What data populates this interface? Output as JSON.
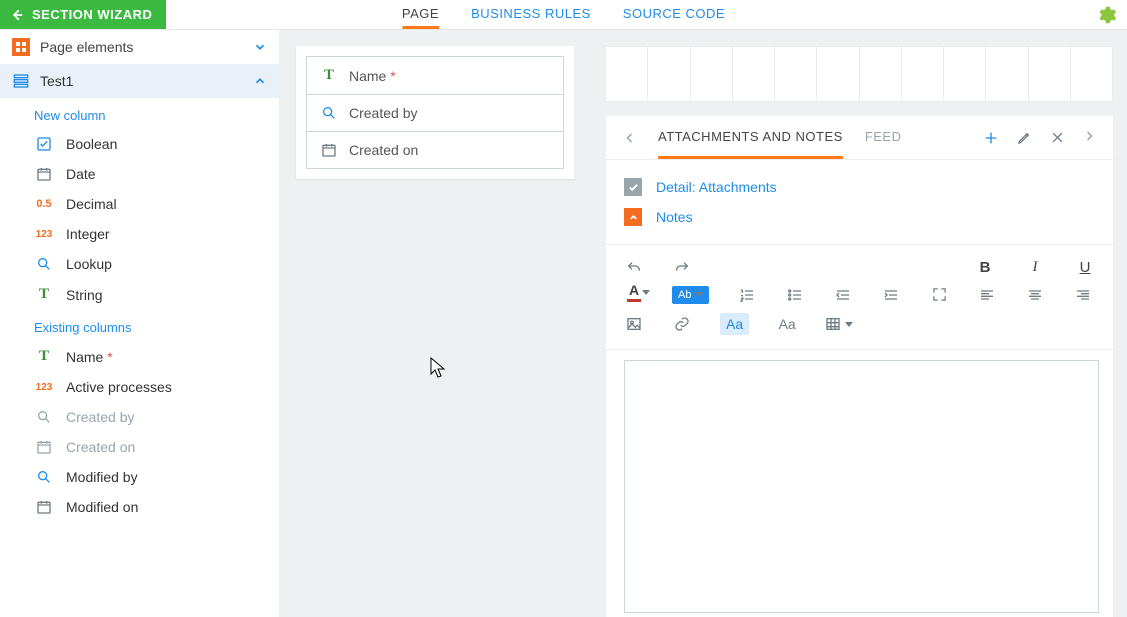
{
  "header": {
    "back_label": "SECTION WIZARD",
    "tabs": [
      "PAGE",
      "BUSINESS RULES",
      "SOURCE CODE"
    ],
    "active_tab": 0
  },
  "sidebar": {
    "page_elements_label": "Page elements",
    "section_label": "Test1",
    "new_column_title": "New column",
    "existing_columns_title": "Existing columns",
    "new_columns": [
      {
        "icon": "checkbox",
        "label": "Boolean"
      },
      {
        "icon": "date",
        "label": "Date"
      },
      {
        "icon": "decimal",
        "label": "Decimal"
      },
      {
        "icon": "integer",
        "label": "Integer"
      },
      {
        "icon": "lookup",
        "label": "Lookup"
      },
      {
        "icon": "text",
        "label": "String"
      }
    ],
    "existing_columns": [
      {
        "icon": "text",
        "label": "Name",
        "required": true,
        "used": false
      },
      {
        "icon": "integer",
        "label": "Active processes",
        "required": false,
        "used": false
      },
      {
        "icon": "lookup",
        "label": "Created by",
        "required": false,
        "used": true
      },
      {
        "icon": "date",
        "label": "Created on",
        "required": false,
        "used": true
      },
      {
        "icon": "lookup",
        "label": "Modified by",
        "required": false,
        "used": false
      },
      {
        "icon": "date",
        "label": "Modified on",
        "required": false,
        "used": false
      }
    ]
  },
  "canvas_fields": [
    {
      "icon": "text",
      "label": "Name",
      "required": true
    },
    {
      "icon": "lookup",
      "label": "Created by",
      "required": false
    },
    {
      "icon": "date",
      "label": "Created on",
      "required": false
    }
  ],
  "right": {
    "tabs": [
      "ATTACHMENTS AND NOTES",
      "FEED"
    ],
    "active_tab": 0,
    "details": [
      {
        "style": "grey",
        "label": "Detail: Attachments"
      },
      {
        "style": "orange",
        "label": "Notes"
      }
    ]
  },
  "icons": {
    "decimal": "0.5",
    "integer": "123"
  }
}
